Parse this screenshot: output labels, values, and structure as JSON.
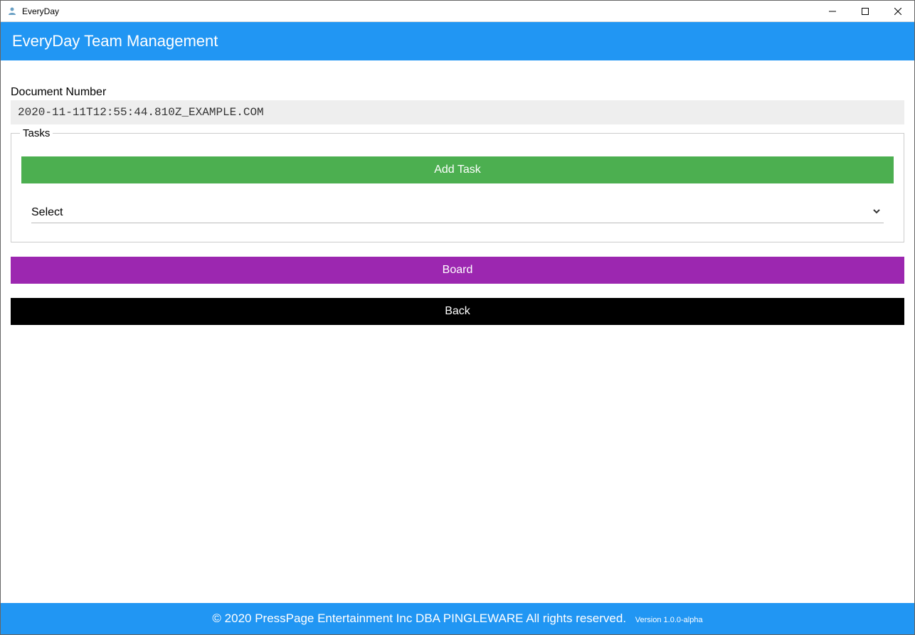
{
  "window": {
    "title": "EveryDay"
  },
  "header": {
    "title": "EveryDay Team Management"
  },
  "form": {
    "document_number_label": "Document Number",
    "document_number_value": "2020-11-11T12:55:44.810Z_EXAMPLE.COM",
    "tasks_legend": "Tasks",
    "add_task_label": "Add Task",
    "select_placeholder": "Select",
    "board_label": "Board",
    "back_label": "Back"
  },
  "footer": {
    "copyright": "© 2020 PressPage Entertainment Inc DBA PINGLEWARE  All rights reserved.",
    "version": "Version 1.0.0-alpha"
  }
}
